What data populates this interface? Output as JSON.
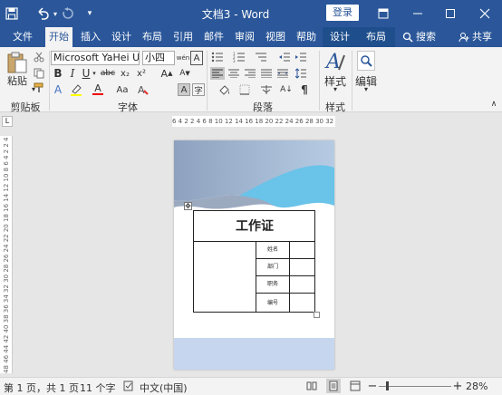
{
  "titlebar": {
    "title": "文档3 - Word",
    "login": "登录",
    "word_icon": "word-logo-icon",
    "undo_icon": "undo-icon",
    "redo_icon": "redo-icon",
    "customize_icon": "quick-access-dropdown-icon"
  },
  "tabs": {
    "file": "文件",
    "home": "开始",
    "insert": "插入",
    "design": "设计",
    "layout": "布局",
    "references": "引用",
    "mailings": "邮件",
    "review": "审阅",
    "view": "视图",
    "help": "帮助",
    "table_design": "设计",
    "table_layout": "布局",
    "search": "搜索",
    "share": "共享"
  },
  "ribbon": {
    "paste": "粘贴",
    "clipboard": "剪贴板",
    "font_group": "字体",
    "paragraph_group": "段落",
    "styles_group": "样式",
    "styles": "样式",
    "editing": "编辑",
    "font_name": "Microsoft YaHei UI",
    "font_size": "小四",
    "bold": "B",
    "italic": "I",
    "underline": "U",
    "strike": "abc",
    "subscript": "x₂",
    "superscript": "x²",
    "font_color_a": "A",
    "font_size_aa": "Aa"
  },
  "ruler": {
    "horizontal": "6 4 2  2 4 6 8 10 12 14 16 18 20 22 24 26 28 30 32 34  40 42",
    "vertical": "48 46 44 42 40 38 36 34 32 30 28 26 24 22 20 18 16 14 12 10 8 6 4 2  2 4 6 8 10 12 14 16 18 20"
  },
  "document": {
    "card_title": "工作证",
    "fields": [
      "姓名",
      "部门",
      "职务",
      "编号"
    ]
  },
  "status": {
    "page": "第 1 页，共 1 页",
    "words": "11 个字",
    "language": "中文(中国)",
    "zoom": "28%"
  },
  "colors": {
    "accent": "#2b579a",
    "wave_dark": "#8da1bf",
    "wave_light": "#68c1e8",
    "footer_band": "#c5d6ef"
  }
}
